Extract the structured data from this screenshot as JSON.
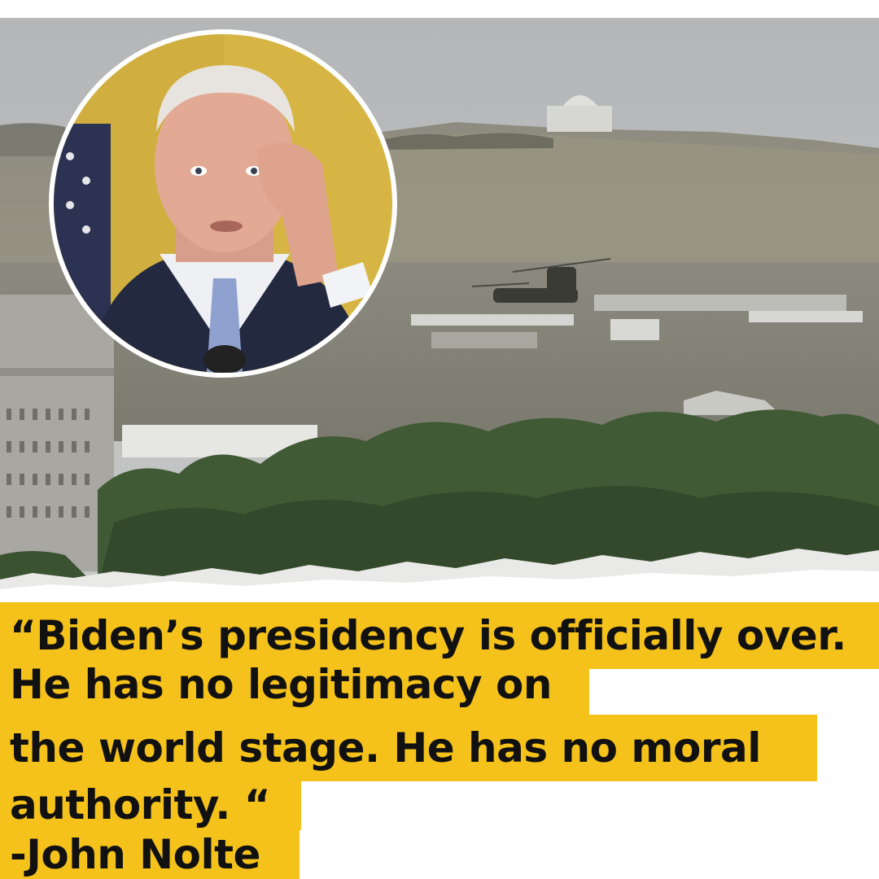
{
  "scene": {
    "description_icon": "city-landscape-photo",
    "colors": {
      "sky": "#bfc1c3",
      "hill": "#8d8b7e",
      "trees": "#3f5a34",
      "building": "#a9a8a3",
      "torn_paper": "#ffffff"
    }
  },
  "portrait": {
    "icon": "man-portrait-photo",
    "colors": {
      "backdrop": "#d9b845",
      "suit": "#23293f",
      "shirt": "#eef0f4",
      "tie": "#8fa2cf",
      "skin": "#e2aa94",
      "hair": "#e7e4df"
    }
  },
  "quote": {
    "lines": [
      "“Biden’s presidency is officially over.",
      "He has no legitimacy on",
      "the world stage. He has no moral",
      "authority. “",
      "-John Nolte"
    ],
    "highlight_color": "#f5c21b",
    "text_color": "#111111"
  }
}
